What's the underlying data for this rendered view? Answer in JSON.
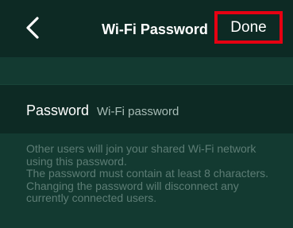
{
  "header": {
    "title": "Wi-Fi Password",
    "done_label": "Done"
  },
  "password_field": {
    "label": "Password",
    "placeholder": "Wi-Fi password",
    "value": ""
  },
  "help_text": [
    "Other users will join your shared Wi-Fi network using this password.",
    "The password must contain at least 8 characters.",
    "Changing the password will disconnect any currently connected users."
  ],
  "colors": {
    "background": "#0d2a24",
    "section_band": "#133a31",
    "highlight_border": "#e60012",
    "help_text": "#5d7d75"
  }
}
